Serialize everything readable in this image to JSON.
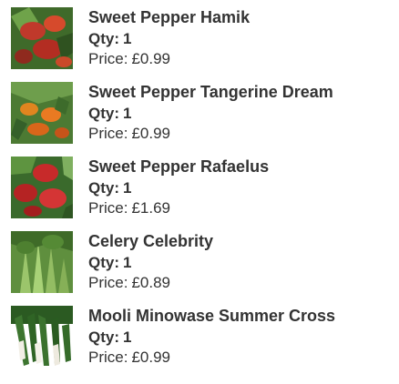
{
  "basket": {
    "qty_label": "Qty:",
    "price_label": "Price:",
    "items": [
      {
        "name": "Sweet Pepper Hamik",
        "qty": "1",
        "price": "£0.99",
        "image": "sweet-pepper-hamik-photo"
      },
      {
        "name": "Sweet Pepper Tangerine Dream",
        "qty": "1",
        "price": "£0.99",
        "image": "sweet-pepper-tangerine-dream-photo"
      },
      {
        "name": "Sweet Pepper Rafaelus",
        "qty": "1",
        "price": "£1.69",
        "image": "sweet-pepper-rafaelus-photo"
      },
      {
        "name": "Celery Celebrity",
        "qty": "1",
        "price": "£0.89",
        "image": "celery-celebrity-photo"
      },
      {
        "name": "Mooli Minowase Summer Cross",
        "qty": "1",
        "price": "£0.99",
        "image": "mooli-minowase-photo"
      }
    ]
  }
}
